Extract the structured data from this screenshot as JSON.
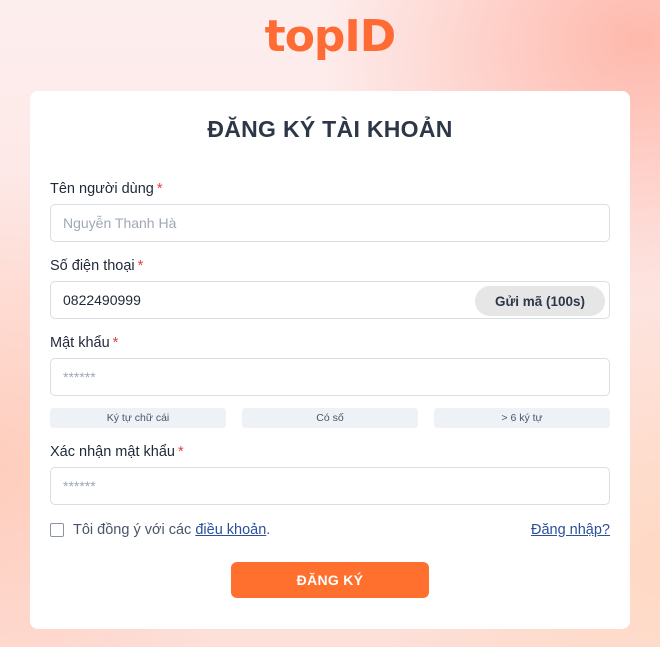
{
  "brand": {
    "logo_text": "topID",
    "accent_color": "#ff6b35"
  },
  "form": {
    "title": "ĐĂNG KÝ TÀI KHOẢN",
    "required_marker": "*",
    "username": {
      "label": "Tên người dùng",
      "placeholder": "Nguyễn Thanh Hà",
      "value": ""
    },
    "phone": {
      "label": "Số điện thoại",
      "value": "0822490999",
      "otp_button": "Gửi mã (100s)"
    },
    "password": {
      "label": "Mật khẩu",
      "placeholder": "******",
      "value": ""
    },
    "password_hints": [
      "Ký tự chữ cái",
      "Có số",
      "> 6 ký tự"
    ],
    "confirm_password": {
      "label": "Xác nhận mật khẩu",
      "placeholder": "******",
      "value": ""
    },
    "agree": {
      "checked": false,
      "text": "Tôi đồng ý với các",
      "link": "điều khoản",
      "suffix": "."
    },
    "login_link": "Đăng nhập?",
    "submit_label": "ĐĂNG KÝ"
  }
}
